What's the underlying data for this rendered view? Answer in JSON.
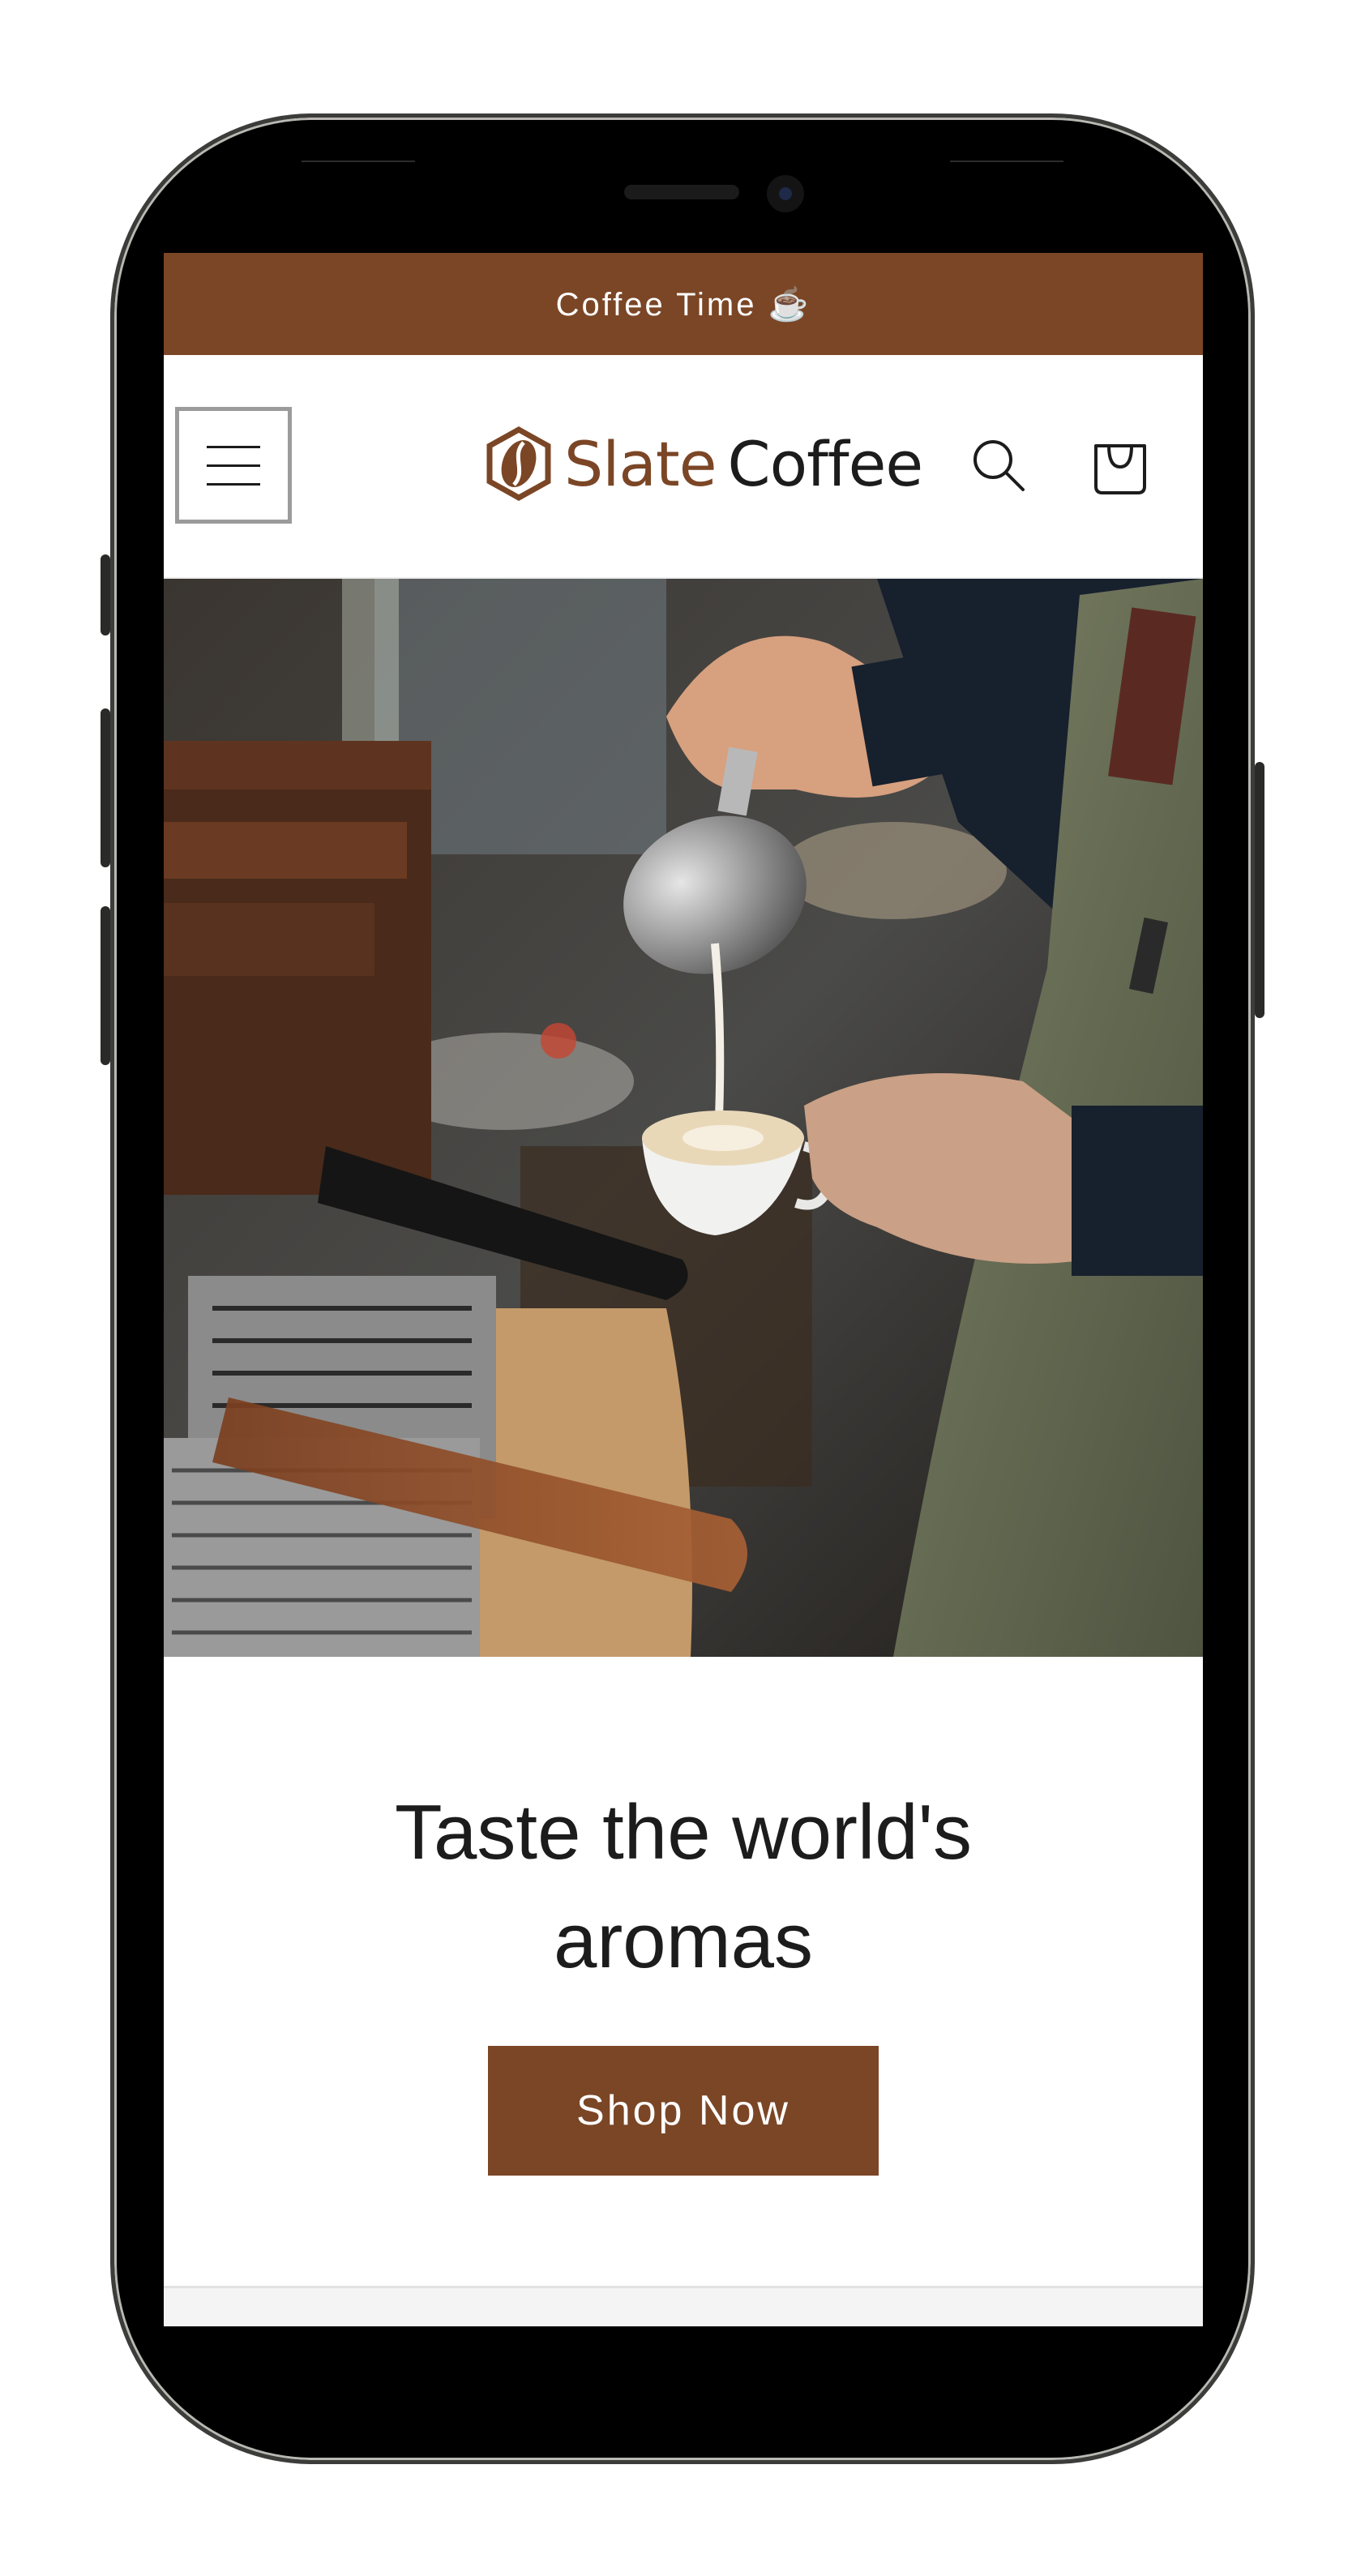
{
  "announcement": {
    "text": "Coffee Time ☕"
  },
  "header": {
    "brand_part1": "Slate",
    "brand_part2": "Coffee",
    "menu_icon": "hamburger-menu-icon",
    "search_icon": "search-icon",
    "cart_icon": "shopping-bag-icon"
  },
  "hero": {
    "image": "barista-pouring-latte-photo",
    "headline": "Taste the world's aromas",
    "button_label": "Shop Now"
  },
  "colors": {
    "brand": "#7b4626",
    "text": "#1c1c1c",
    "background": "#ffffff"
  }
}
